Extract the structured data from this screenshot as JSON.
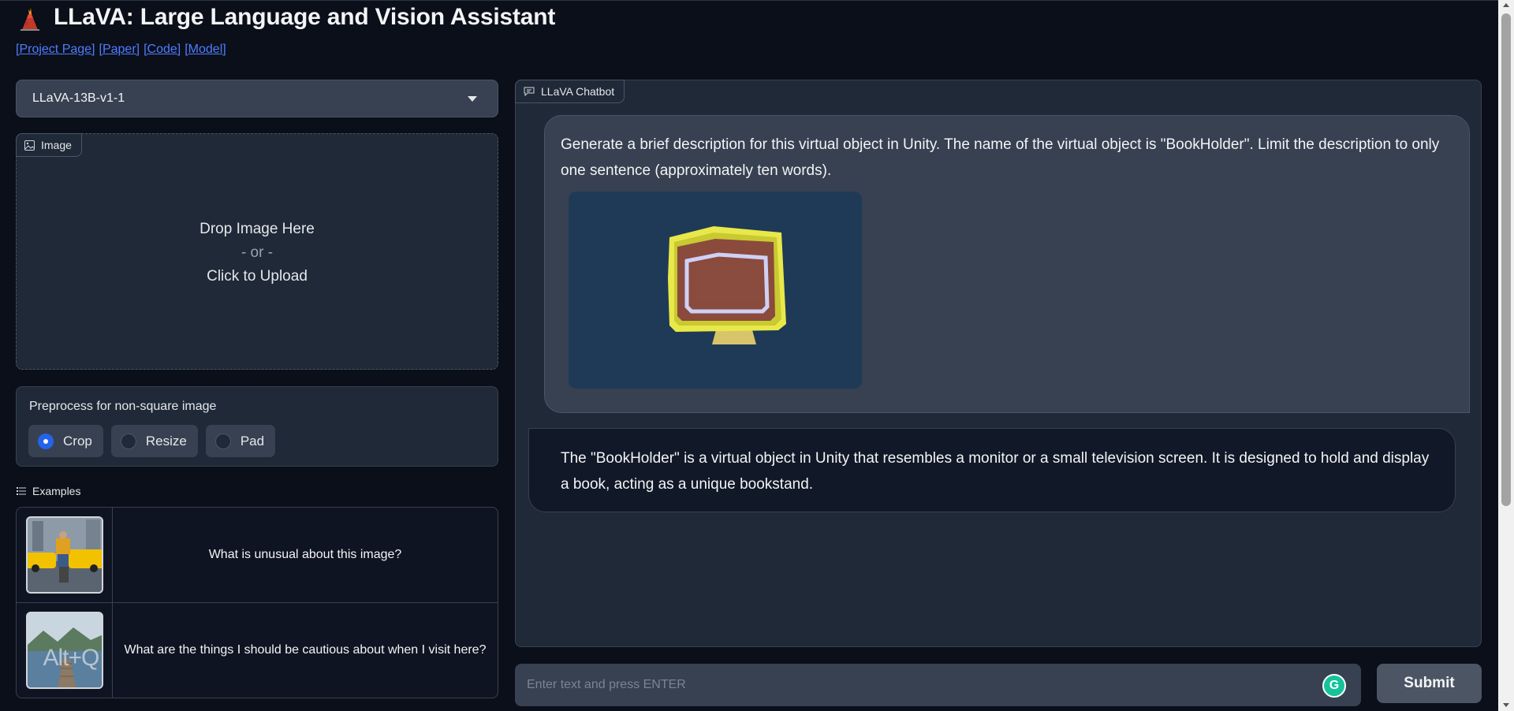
{
  "app": {
    "title": "LLaVA: Large Language and Vision Assistant",
    "logo_icon": "volcano-icon"
  },
  "links": [
    "[Project Page]",
    "[Paper]",
    "[Code]",
    "[Model]"
  ],
  "model_selector": {
    "value": "LLaVA-13B-v1-1"
  },
  "image_upload": {
    "label": "Image",
    "drop_text": "Drop Image Here",
    "or_text": "- or -",
    "click_text": "Click to Upload"
  },
  "preprocess": {
    "label": "Preprocess for non-square image",
    "options": [
      "Crop",
      "Resize",
      "Pad"
    ],
    "selected": "Crop"
  },
  "examples": {
    "label": "Examples",
    "items": [
      {
        "text": "What is unusual about this image?"
      },
      {
        "text": "What are the things I should be cautious about when I visit here?"
      }
    ],
    "thumb_overlay": "Alt+Q"
  },
  "chat": {
    "label": "LLaVA Chatbot",
    "user_message": "Generate a brief description for this virtual object in Unity. The name of the virtual object is \"BookHolder\". Limit the description to only one sentence (approximately ten words).",
    "bot_message": "The \"BookHolder\" is a virtual object in Unity that resembles a monitor or a small television screen. It is designed to hold and display a book, acting as a unique bookstand."
  },
  "input": {
    "placeholder": "Enter text and press ENTER",
    "value": ""
  },
  "submit_label": "Submit",
  "colors": {
    "accent": "#2563eb",
    "link": "#4f7cff",
    "background": "#0b0f19"
  }
}
